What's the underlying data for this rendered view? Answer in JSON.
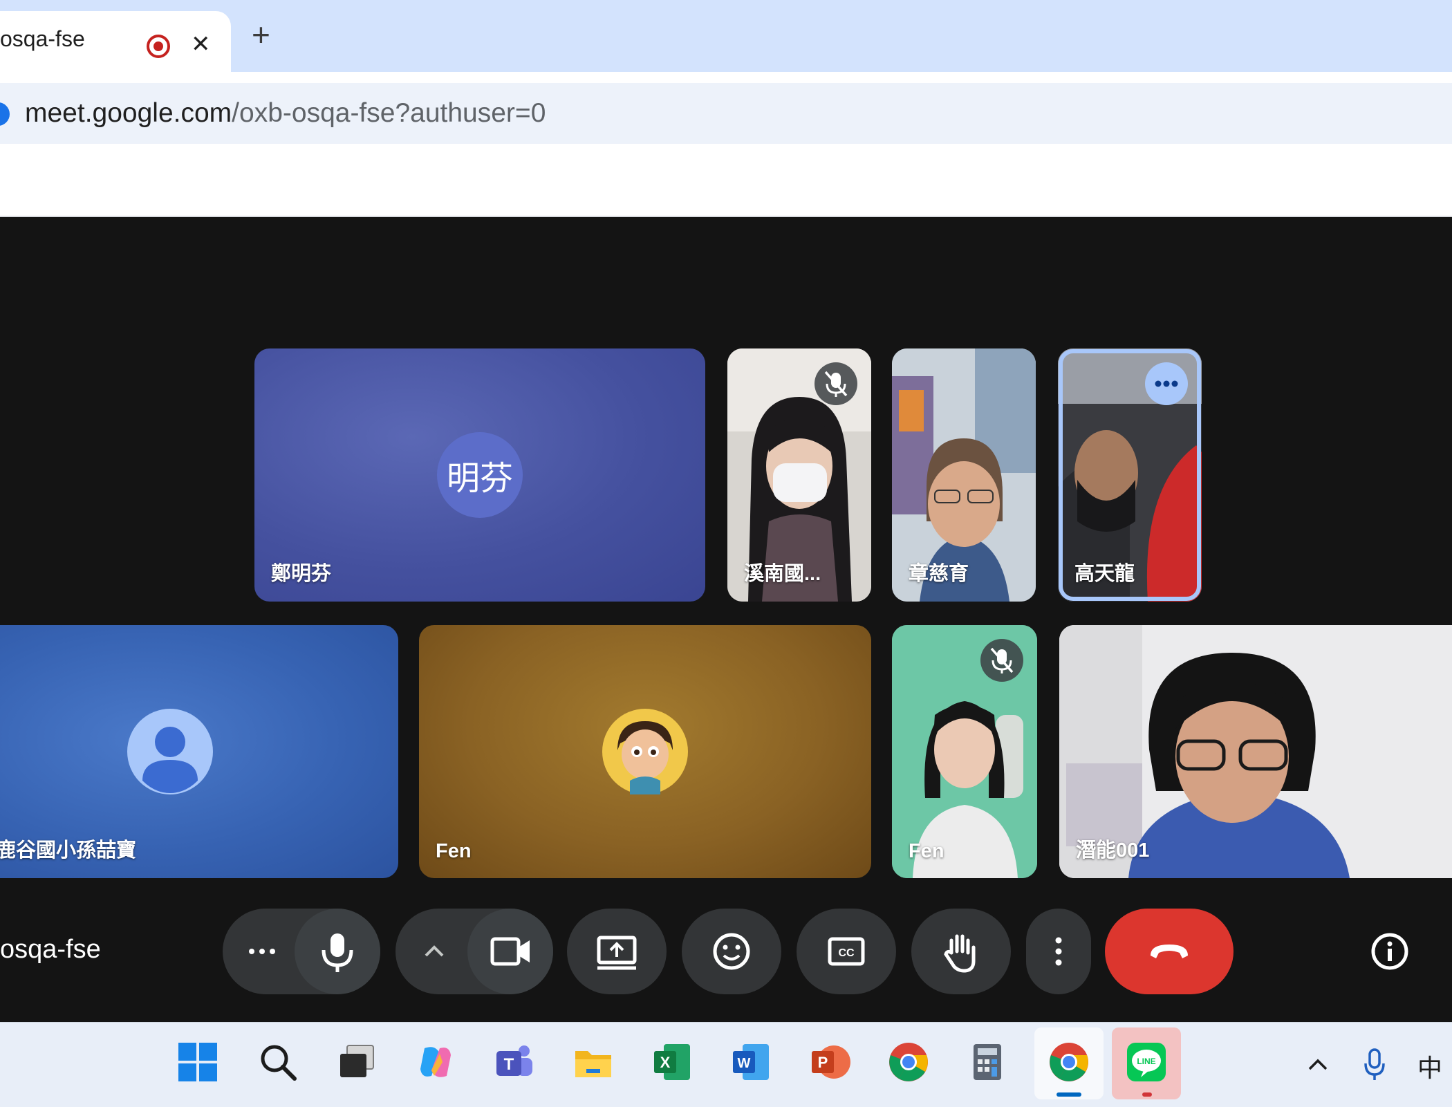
{
  "browser": {
    "tab_title": "osqa-fse",
    "tab_close": "✕",
    "new_tab": "+",
    "url_main": "meet.google.com",
    "url_rest": "/oxb-osqa-fse?authuser=0"
  },
  "participants": {
    "p1": {
      "name": "鄭明芬",
      "initials": "明芬"
    },
    "p2": {
      "name": "溪南國..."
    },
    "p3": {
      "name": "章慈育"
    },
    "p4": {
      "name": "高天龍"
    },
    "p5": {
      "name": "鹿谷國小孫喆寶"
    },
    "p6": {
      "name": "Fen"
    },
    "p7": {
      "name": "Fen"
    },
    "p8": {
      "name": "潛能001"
    }
  },
  "controls": {
    "meeting_code": "osqa-fse"
  },
  "taskbar": {
    "ime_label": "中",
    "chevron": "^"
  },
  "colors": {
    "stage_bg": "#141414",
    "end_call": "#dc362e",
    "tab_strip": "#d3e3fd",
    "avatar_blue": "#5c6dc9"
  }
}
